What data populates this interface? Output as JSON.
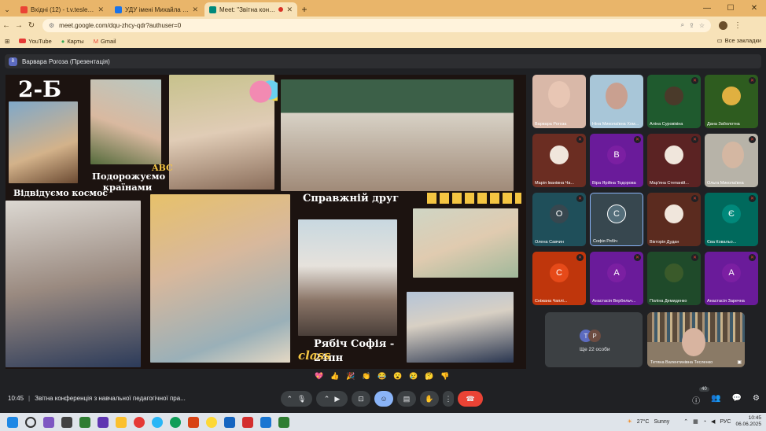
{
  "browser": {
    "tabs": [
      {
        "label": "Вхідні (12) - t.v.teslenko@npu.edu.ua",
        "color": "#ea4335",
        "active": false
      },
      {
        "label": "УДУ імені Михайла Драгоманова",
        "color": "#1a73e8",
        "active": false
      },
      {
        "label": "Meet: \"Звітна конференція з…",
        "color": "#00897b",
        "active": true
      }
    ],
    "url": "meet.google.com/dqu-zhcy-qdr?authuser=0",
    "bookmarks": [
      "YouTube",
      "Карты",
      "Gmail"
    ],
    "all_bookmarks": "Все закладки"
  },
  "meet": {
    "presenter": "Варвара Рогоза (Презентація)",
    "presenter_initial": "В",
    "slide": {
      "title": "2-Б",
      "labels": [
        "Подорожуємо країнами",
        "Відвідуємо космос",
        "Справжній друг",
        "Рябіч Софія - 24пн",
        "class",
        "ABC"
      ]
    },
    "participants": [
      {
        "name": "Варвара Рогоза",
        "type": "video",
        "bg": "#d9b8a8"
      },
      {
        "name": "Ніна Миколаївна Хом...",
        "type": "video",
        "bg": "#a8c6d8"
      },
      {
        "name": "Аліна Суровікіна",
        "type": "photo",
        "bg": "#1f5a2e"
      },
      {
        "name": "Дана Заболотна",
        "type": "photo",
        "bg": "#2e5c1f"
      },
      {
        "name": "Марія Іванівна Ча...",
        "type": "photo",
        "bg": "#6b2d22"
      },
      {
        "name": "Віра Ярійна Тодорова",
        "type": "letter",
        "letter": "В",
        "bg": "#6a1b9a"
      },
      {
        "name": "Мар'яна Степаній...",
        "type": "photo",
        "bg": "#5b2323"
      },
      {
        "name": "Ольга Миколаївна",
        "type": "video",
        "bg": "#b7b3a8"
      },
      {
        "name": "Олена Савчин",
        "type": "letter",
        "letter": "О",
        "bg": "#1f4f5a"
      },
      {
        "name": "Софія Рябіч",
        "type": "letter",
        "letter": "С",
        "bg": "#37474f"
      },
      {
        "name": "Вікторія Дудан",
        "type": "photo",
        "bg": "#5b2b1f"
      },
      {
        "name": "Єва Ковальо...",
        "type": "letter",
        "letter": "Є",
        "bg": "#00695c"
      },
      {
        "name": "Сніжана Чаплі...",
        "type": "letter",
        "letter": "С",
        "bg": "#bf360c"
      },
      {
        "name": "Анастасія Вербельч...",
        "type": "letter",
        "letter": "А",
        "bg": "#6a1b9a"
      },
      {
        "name": "Поліна Демиденко",
        "type": "photo",
        "bg": "#1f4a2a"
      },
      {
        "name": "Анастасія Заречна",
        "type": "letter",
        "letter": "А",
        "bg": "#6a1b9a"
      }
    ],
    "others": {
      "label": "Ще 22 особи",
      "initials": [
        "Т",
        "Р"
      ]
    },
    "self_tile": {
      "name": "Тетяна Валентинівна Тесленко"
    },
    "reactions": [
      "💖",
      "👍",
      "🎉",
      "👏",
      "😂",
      "😮",
      "😢",
      "🤔",
      "👎"
    ],
    "time": "10:45",
    "meeting_title": "Звітна конференція з навчальної педагогічної пра...",
    "participant_count": "40",
    "controls": [
      "mic-button",
      "camera-button",
      "present-button",
      "emoji-button",
      "captions-button",
      "raise-hand-button",
      "more-button",
      "end-call-button"
    ]
  },
  "taskbar": {
    "weather": "27°C",
    "weather_desc": "Sunny",
    "lang": "РУС",
    "time": "10:45",
    "date": "06.06.2025"
  }
}
